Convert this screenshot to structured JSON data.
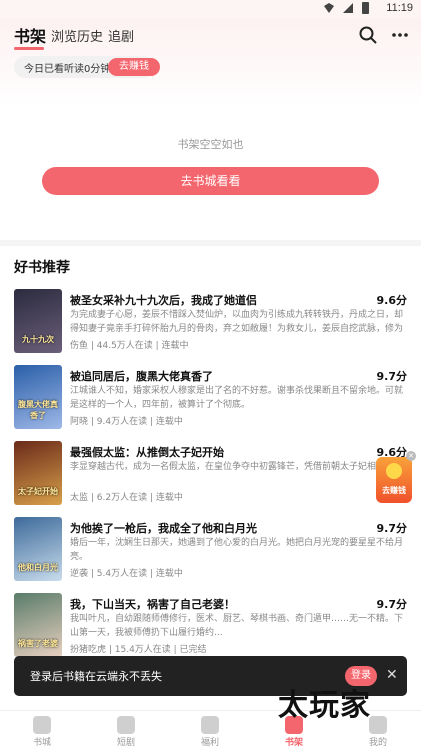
{
  "status_bar": {
    "time": "11:19"
  },
  "header": {
    "tabs": [
      {
        "label": "书架",
        "active": true
      },
      {
        "label": "浏览历史",
        "active": false
      },
      {
        "label": "追剧",
        "active": false
      }
    ],
    "icons": [
      "search-icon",
      "more-icon"
    ]
  },
  "reading": {
    "text": "今日已看听读0分钟",
    "button": "去赚钱"
  },
  "shelf": {
    "empty_text": "书架空空如也",
    "button": "去书城看看"
  },
  "recommend": {
    "title": "好书推荐",
    "books": [
      {
        "title": "被圣女采补九十九次后，我成了她道侣",
        "score": "9.6分",
        "desc": "为完成妻子心愿，姜辰不惜踩入焚仙炉，以血肉为引练成九转转铁丹，丹成之日，却得知妻子竟亲手打碎怀胎九月的骨肉，弃之如敝履！为救女儿，姜辰自挖武脉，修为尽废，却...",
        "meta": "伤鱼 | 44.5万人在读 | 连载中",
        "cover_colors": [
          "#2b2b3f",
          "#6b5f7a"
        ],
        "cover_text": "九十九次"
      },
      {
        "title": "被追同居后，腹黑大佬真香了",
        "score": "9.7分",
        "desc": "江城谁人不知，婚家采权人穆家是出了名的不好惹。谢事杀伐果断且不留余地。可就是这样的一个人，四年前，被算计了个彻底。",
        "meta": "阿晓 | 9.4万人在读 | 连载中",
        "cover_colors": [
          "#2a5fa8",
          "#9fb8e8"
        ],
        "cover_text": "腹黑大佬真香了"
      },
      {
        "title": "最强假太监：从推倒太子妃开始",
        "score": "9.6分",
        "desc": "李显穿越古代，成为一名假太监，在皇位争夺中初露锋芒，凭借前朝太子妃相中...",
        "meta": "太监 | 6.2万人在读 | 连载中",
        "cover_colors": [
          "#6a2a1a",
          "#d8a04a"
        ],
        "cover_text": "太子妃开始"
      },
      {
        "title": "为他挨了一枪后，我成全了他和白月光",
        "score": "9.7分",
        "desc": "婚后一年，沈娴生日那天，她遇到了他心爱的白月光。她把白月光宠的要星星不给月亮。",
        "meta": "逆袭 | 5.4万人在读 | 连载中",
        "cover_colors": [
          "#3d6a9a",
          "#c9dcec"
        ],
        "cover_text": "他和白月光"
      },
      {
        "title": "我，下山当天，祸害了自己老婆！",
        "score": "9.7分",
        "desc": "我叫叶凡，自幼跟随师傅修行，医术、厨艺、琴棋书画、奇门遁甲……无一不精。下山第一天，我被师傅扔下山履行婚约...",
        "meta": "扮猪吃虎 | 15.4万人在读 | 已完结",
        "cover_colors": [
          "#5a7c6a",
          "#e8d0c0"
        ],
        "cover_text": "祸害了老婆"
      }
    ]
  },
  "floating_reward": {
    "label": "去赚钱"
  },
  "login_toast": {
    "text": "登录后书籍在云端永不丢失",
    "button": "登录",
    "close": "✕"
  },
  "bottom_nav": [
    {
      "label": "书城",
      "active": false
    },
    {
      "label": "短剧",
      "active": false
    },
    {
      "label": "福利",
      "active": false
    },
    {
      "label": "书架",
      "active": true
    },
    {
      "label": "我的",
      "active": false
    }
  ],
  "watermark": "太玩家",
  "colors": {
    "accent": "#f4666d"
  }
}
